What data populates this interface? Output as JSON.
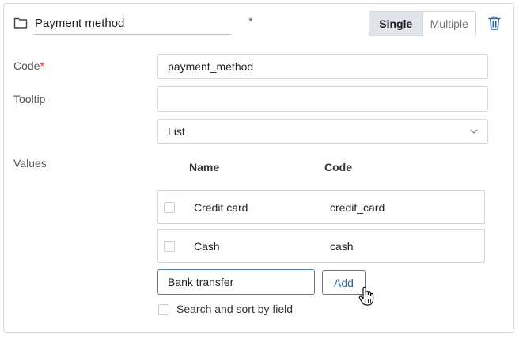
{
  "header": {
    "title_value": "Payment method",
    "asterisk": "*",
    "mode_single": "Single",
    "mode_multiple": "Multiple"
  },
  "form": {
    "code_label": "Code",
    "code_required": "*",
    "code_value": "payment_method",
    "tooltip_label": "Tooltip",
    "tooltip_value": "",
    "type_value": "List",
    "values_label": "Values"
  },
  "values_table": {
    "columns": [
      "Name",
      "Code"
    ],
    "rows": [
      {
        "name": "Credit card",
        "code": "credit_card",
        "checked": false
      },
      {
        "name": "Cash",
        "code": "cash",
        "checked": false
      }
    ]
  },
  "new_value": {
    "input_value": "Bank transfer",
    "add_label": "Add"
  },
  "search_sort": {
    "label": "Search and sort by field",
    "checked": false
  },
  "colors": {
    "accent": "#2d6aa6",
    "required": "#dd3333",
    "trash": "#2d6aa6"
  }
}
